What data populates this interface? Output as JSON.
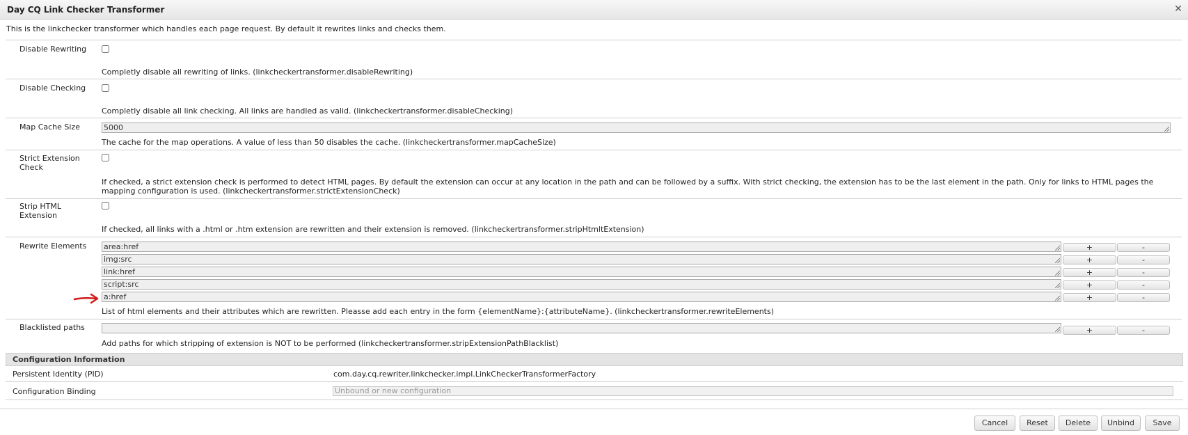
{
  "dialog": {
    "title": "Day CQ Link Checker Transformer",
    "description": "This is the linkchecker transformer which handles each page request. By default it rewrites links and checks them."
  },
  "fields": {
    "disable_rewriting": {
      "label": "Disable Rewriting",
      "checked": false,
      "help": "Completly disable all rewriting of links. (linkcheckertransformer.disableRewriting)"
    },
    "disable_checking": {
      "label": "Disable Checking",
      "checked": false,
      "help": "Completly disable all link checking. All links are handled as valid. (linkcheckertransformer.disableChecking)"
    },
    "map_cache_size": {
      "label": "Map Cache Size",
      "value": "5000",
      "help": "The cache for the map operations. A value of less than 50 disables the cache. (linkcheckertransformer.mapCacheSize)"
    },
    "strict_extension_check": {
      "label": "Strict Extension Check",
      "checked": false,
      "help": "If checked, a strict extension check is performed to detect HTML pages. By default the extension can occur at any location in the path and can be followed by a suffix. With strict checking, the extension has to be the last element in the path. Only for links to HTML pages the mapping configuration is used. (linkcheckertransformer.strictExtensionCheck)"
    },
    "strip_html_extension": {
      "label": "Strip HTML Extension",
      "checked": false,
      "help": "If checked, all links with a .html or .htm extension are rewritten and their extension is removed. (linkcheckertransformer.stripHtmltExtension)"
    },
    "rewrite_elements": {
      "label": "Rewrite Elements",
      "values": [
        "area:href",
        "img:src",
        "link:href",
        "script:src",
        "a:href"
      ],
      "help": "List of html elements and their attributes which are rewritten. Pleasse add each entry in the form {elementName}:{attributeName}. (linkcheckertransformer.rewriteElements)"
    },
    "blacklisted_paths": {
      "label": "Blacklisted paths",
      "values": [
        ""
      ],
      "help": "Add paths for which stripping of extension is NOT to be performed (linkcheckertransformer.stripExtensionPathBlacklist)"
    }
  },
  "buttons": {
    "add": "+",
    "remove": "-"
  },
  "config_info": {
    "heading": "Configuration Information",
    "pid_label": "Persistent Identity (PID)",
    "pid_value": "com.day.cq.rewriter.linkchecker.impl.LinkCheckerTransformerFactory",
    "binding_label": "Configuration Binding",
    "binding_placeholder": "Unbound or new configuration"
  },
  "footer": {
    "cancel": "Cancel",
    "reset": "Reset",
    "delete": "Delete",
    "unbind": "Unbind",
    "save": "Save"
  },
  "colors": {
    "annotation_arrow": "#d11a1a"
  },
  "icons": {
    "close": "close-icon",
    "annotation": "red-arrow-icon"
  }
}
